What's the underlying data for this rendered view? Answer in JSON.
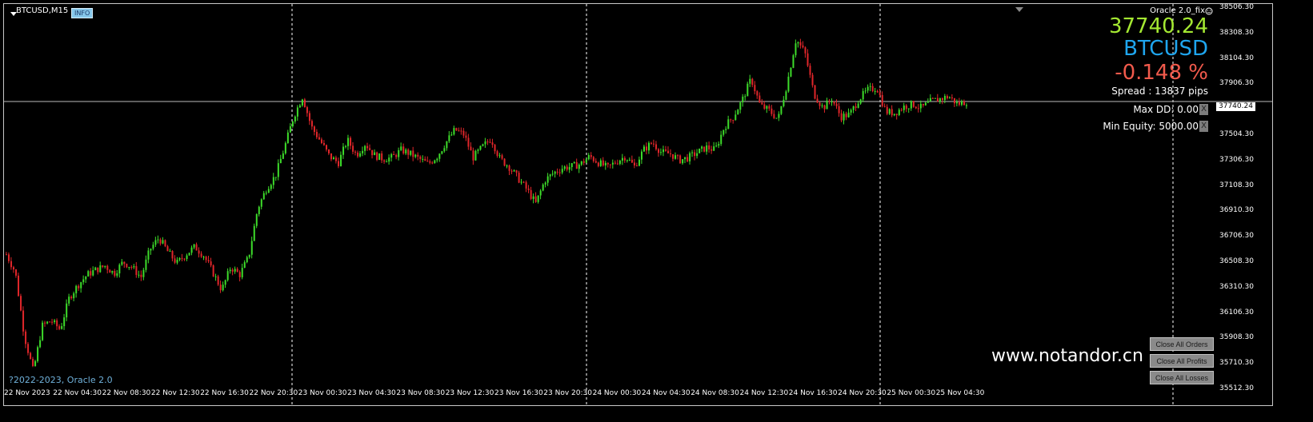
{
  "window": {
    "symbol_timeframe": "BTCUSD,M15",
    "info_badge": "INFO",
    "indicator_name": "Oracle 2.0_fix"
  },
  "panel": {
    "price": "37740.24",
    "symbol": "BTCUSD",
    "change": "-0.148 %",
    "spread": "Spread : 13837 pips",
    "max_dd": "Max DD: 0.00",
    "min_equity": "Min Equity: 5000.00",
    "close_x": "X"
  },
  "colors": {
    "bull": "#3ddc2a",
    "bear": "#e0262a",
    "grid_sep": "#ffffff",
    "price_line": "#bdbdbd",
    "price_text": "#a4e832",
    "symbol_text": "#1fa6ef",
    "change_text": "#f15a4c"
  },
  "watermark": "www.notandor.cn",
  "copyright": "?2022-2023, Oracle 2.0",
  "buttons": {
    "close_all_orders": "Close All Orders",
    "close_all_profits": "Close All Profits",
    "close_all_losses": "Close All Losses"
  },
  "current_price_marker": "37740.24",
  "price_axis": [
    "38506.30",
    "38308.30",
    "38104.30",
    "37906.30",
    "37702.30",
    "37504.30",
    "37306.30",
    "37108.30",
    "36910.30",
    "36706.30",
    "36508.30",
    "36310.30",
    "36106.30",
    "35908.30",
    "35710.30",
    "35512.30"
  ],
  "time_axis": [
    "22 Nov 2023",
    "22 Nov 04:30",
    "22 Nov 08:30",
    "22 Nov 12:30",
    "22 Nov 16:30",
    "22 Nov 20:30",
    "23 Nov 00:30",
    "23 Nov 04:30",
    "23 Nov 08:30",
    "23 Nov 12:30",
    "23 Nov 16:30",
    "23 Nov 20:30",
    "24 Nov 00:30",
    "24 Nov 04:30",
    "24 Nov 08:30",
    "24 Nov 12:30",
    "24 Nov 16:30",
    "24 Nov 20:30",
    "25 Nov 00:30",
    "25 Nov 04:30"
  ],
  "chart_data": {
    "type": "candlestick",
    "price_range": [
      35512.3,
      38506.3
    ],
    "current_price": 37740.24,
    "close_path": [
      36540,
      36400,
      35900,
      35620,
      35980,
      36020,
      35950,
      36200,
      36300,
      36380,
      36420,
      36450,
      36390,
      36480,
      36440,
      36360,
      36580,
      36670,
      36560,
      36470,
      36540,
      36600,
      36530,
      36400,
      36260,
      36440,
      36380,
      36520,
      36900,
      37060,
      37160,
      37380,
      37620,
      37780,
      37540,
      37430,
      37310,
      37260,
      37440,
      37320,
      37410,
      37320,
      37290,
      37300,
      37360,
      37330,
      37290,
      37250,
      37310,
      37420,
      37520,
      37480,
      37300,
      37380,
      37450,
      37290,
      37230,
      37140,
      37050,
      36940,
      37120,
      37180,
      37220,
      37230,
      37250,
      37310,
      37260,
      37220,
      37270,
      37310,
      37230,
      37360,
      37420,
      37340,
      37330,
      37280,
      37300,
      37340,
      37380,
      37360,
      37540,
      37620,
      37750,
      37920,
      37710,
      37670,
      37600,
      37880,
      38230,
      38120,
      37800,
      37690,
      37760,
      37620,
      37640,
      37760,
      37830,
      37850,
      37660,
      37650,
      37700,
      37720,
      37690,
      37740,
      37760,
      37780,
      37720,
      37740
    ]
  }
}
